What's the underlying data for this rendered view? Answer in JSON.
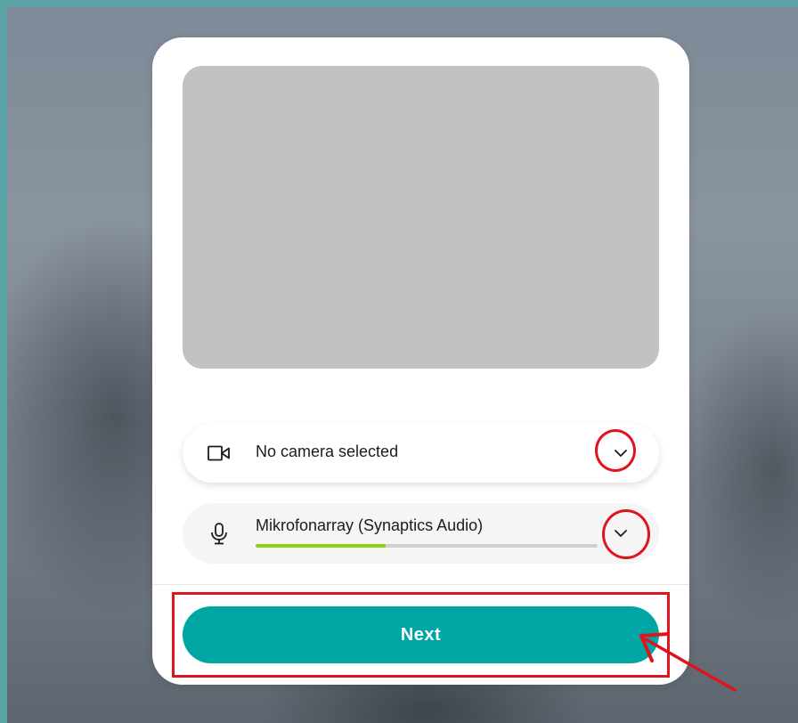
{
  "camera": {
    "label": "No camera selected",
    "icon": "video-camera-icon",
    "dropdown_icon": "chevron-down-icon"
  },
  "microphone": {
    "label": "Mikrofonarray (Synaptics Audio)",
    "icon": "microphone-icon",
    "dropdown_icon": "chevron-down-icon",
    "input_level": 0.38,
    "level_color": "#8fd011"
  },
  "actions": {
    "next_label": "Next",
    "next_color": "#00a6a4"
  },
  "annotations": {
    "color": "#e0141e"
  }
}
